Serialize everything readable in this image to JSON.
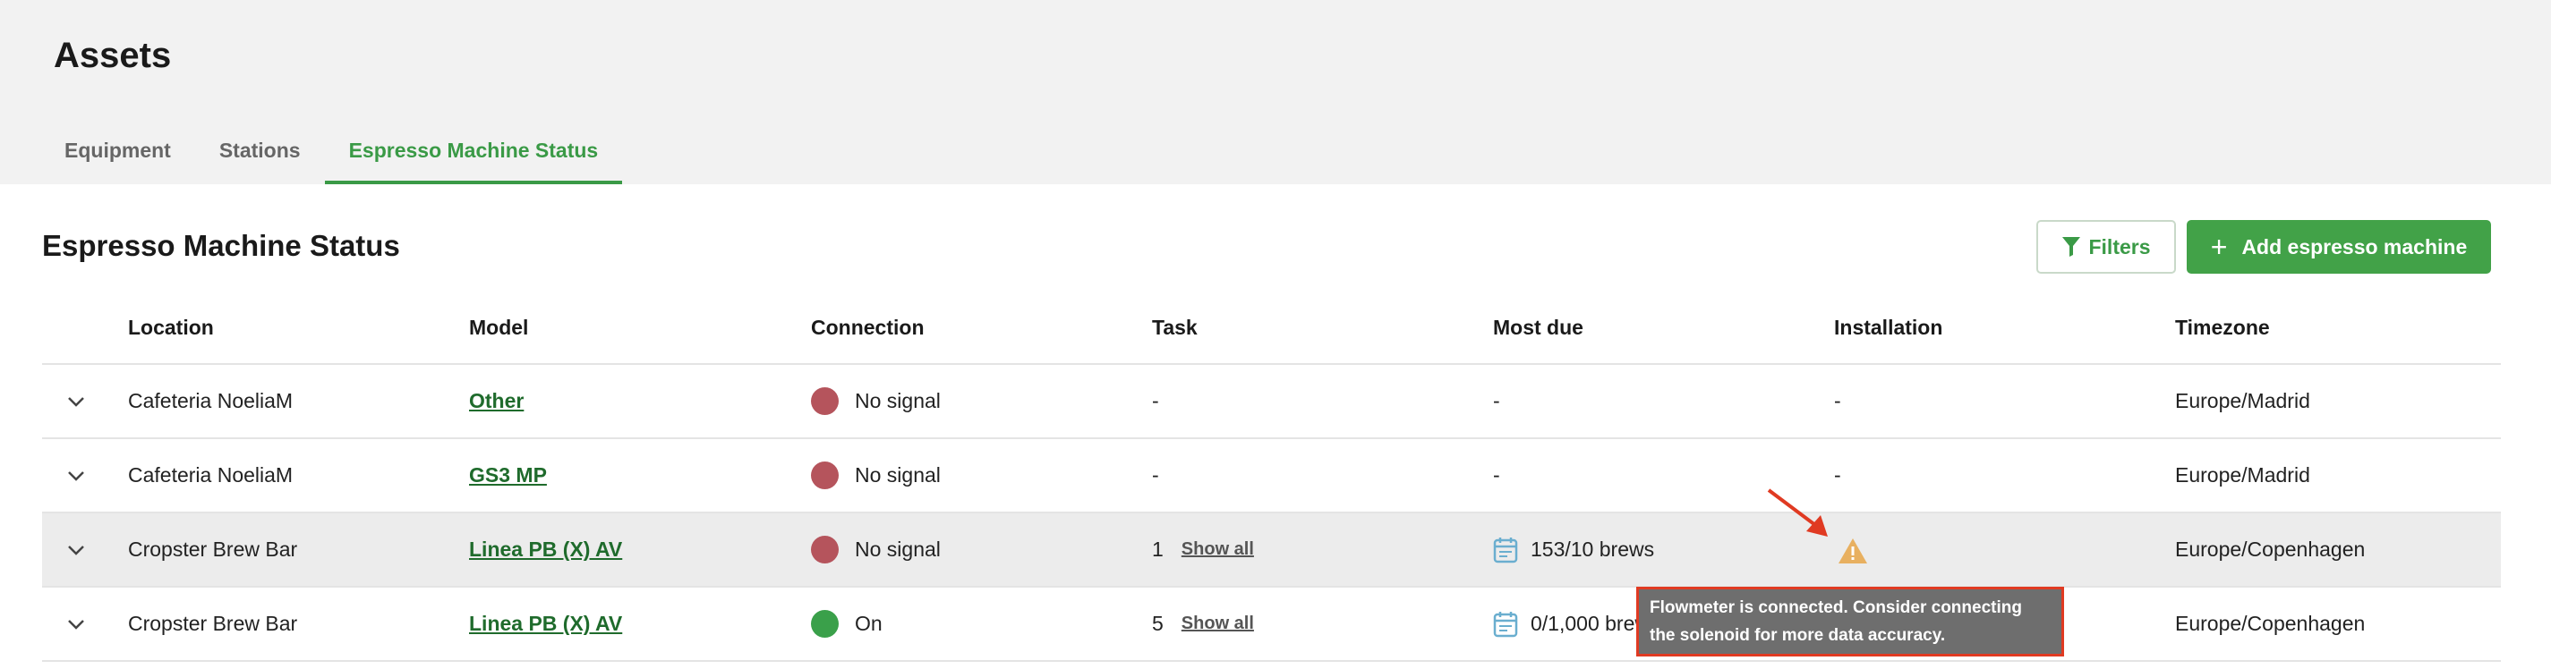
{
  "page": {
    "title": "Assets"
  },
  "tabs": [
    {
      "label": "Equipment"
    },
    {
      "label": "Stations"
    },
    {
      "label": "Espresso Machine Status"
    }
  ],
  "section": {
    "title": "Espresso Machine Status",
    "filters_label": "Filters",
    "add_label": "Add espresso machine"
  },
  "table": {
    "columns": [
      "Location",
      "Model",
      "Connection",
      "Task",
      "Most due",
      "Installation",
      "Timezone"
    ],
    "rows": [
      {
        "location": "Cafeteria NoeliaM",
        "model": "Other",
        "connection": "No signal",
        "connection_status": "no-signal",
        "task": "-",
        "most_due": "-",
        "installation": "-",
        "timezone": "Europe/Madrid"
      },
      {
        "location": "Cafeteria NoeliaM",
        "model": "GS3 MP",
        "connection": "No signal",
        "connection_status": "no-signal",
        "task": "-",
        "most_due": "-",
        "installation": "-",
        "timezone": "Europe/Madrid"
      },
      {
        "location": "Cropster Brew Bar",
        "model": "Linea PB (X) AV",
        "connection": "No signal",
        "connection_status": "no-signal",
        "task": "1",
        "task_link": "Show all",
        "most_due": "153/10 brews",
        "installation": "warning",
        "timezone": "Europe/Copenhagen"
      },
      {
        "location": "Cropster Brew Bar",
        "model": "Linea PB (X) AV",
        "connection": "On",
        "connection_status": "on",
        "task": "5",
        "task_link": "Show all",
        "most_due": "0/1,000 brews",
        "installation": "",
        "timezone": "Europe/Copenhagen"
      }
    ]
  },
  "tooltip": {
    "line1": "Flowmeter is connected. Consider connecting",
    "line2": "the solenoid for more data accuracy."
  },
  "icons": {
    "filter": "filter-icon",
    "plus": "plus-icon",
    "expand": "chevron-down-icon",
    "calendar": "calendar-icon",
    "warning": "warning-triangle-icon"
  },
  "colors": {
    "accent": "#3a9a46",
    "primary_button": "#42a248",
    "status_no_signal": "#b5545c",
    "status_on": "#3aa04a",
    "warning": "#e8b060",
    "annotation": "#e03a22"
  }
}
